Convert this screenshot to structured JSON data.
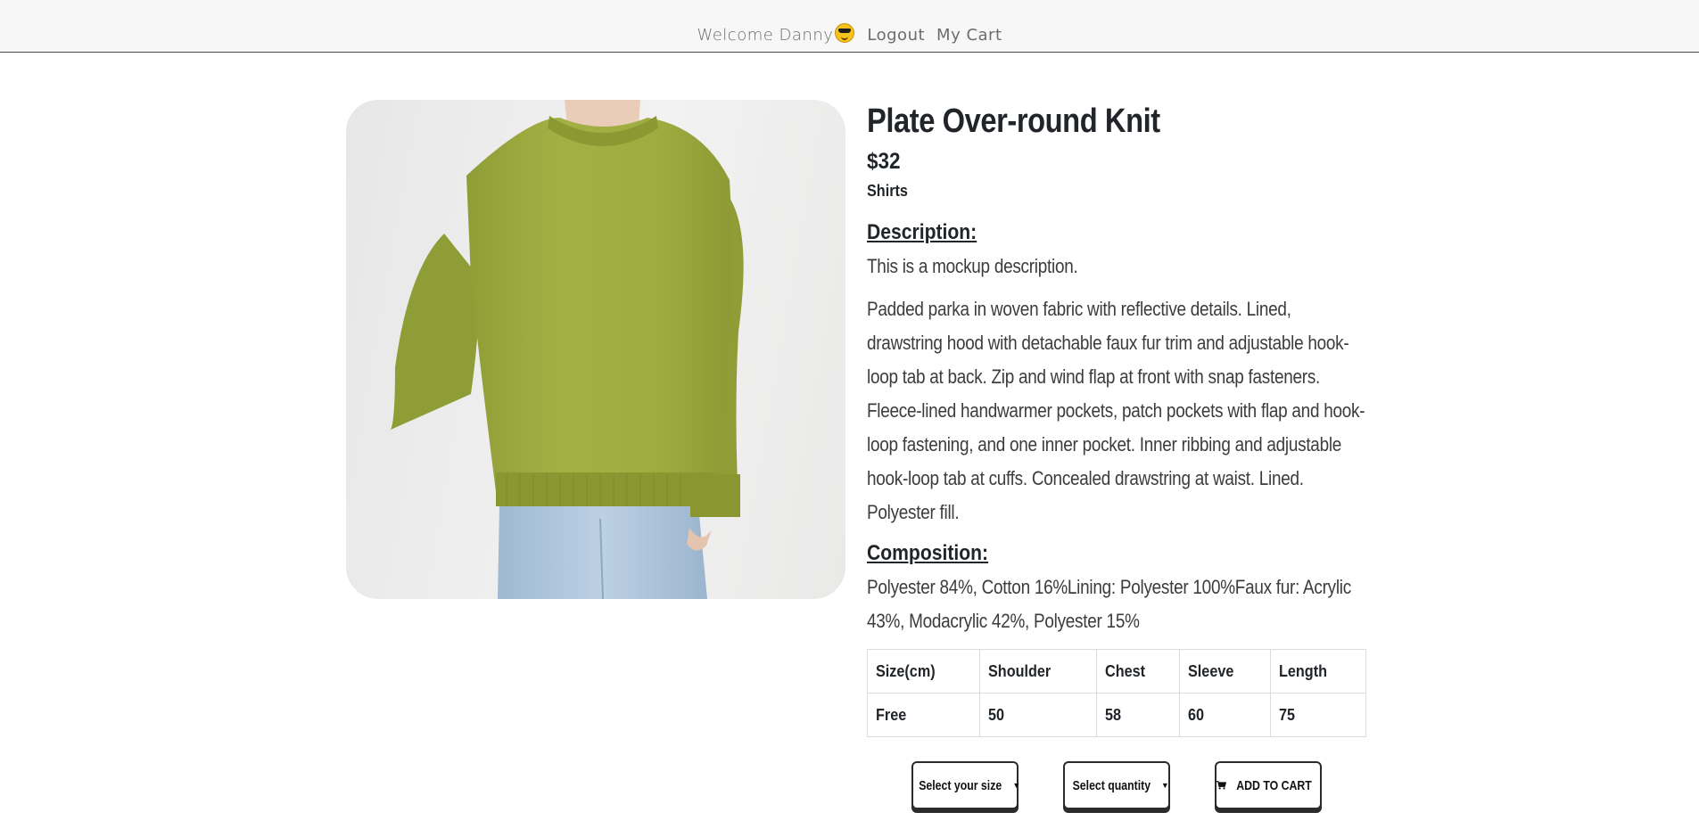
{
  "header": {
    "welcome_text": "Welcome Danny",
    "emoji_icon": "sunglasses-face-icon",
    "logout_label": "Logout",
    "cart_label": "My Cart"
  },
  "product": {
    "image_icon": "green-knit-sweater-photo",
    "title": "Plate Over-round Knit",
    "price": "$32",
    "category": "Shirts",
    "description_heading": "Description:",
    "mockup_description": "This is a mockup description.",
    "long_description": "Padded parka in woven fabric with reflective details. Lined, drawstring hood with detachable faux fur trim and adjustable hook-loop tab at back. Zip and wind flap at front with snap fasteners. Fleece-lined handwarmer pockets, patch pockets with flap and hook-loop fastening, and one inner pocket. Inner ribbing and adjustable hook-loop tab at cuffs. Concealed drawstring at waist. Lined. Polyester fill.",
    "composition_heading": "Composition:",
    "composition": "Polyester 84%, Cotton 16%Lining: Polyester 100%Faux fur: Acrylic 43%, Modacrylic 42%, Polyester 15%"
  },
  "size_table": {
    "headers": [
      "Size(cm)",
      "Shoulder",
      "Chest",
      "Sleeve",
      "Length"
    ],
    "rows": [
      [
        "Free",
        "50",
        "58",
        "60",
        "75"
      ]
    ]
  },
  "actions": {
    "size_select_label": "Select your size",
    "quantity_select_label": "Select quantity",
    "add_to_cart_label": "ADD TO CART",
    "cart_icon": "shopping-cart-icon"
  }
}
